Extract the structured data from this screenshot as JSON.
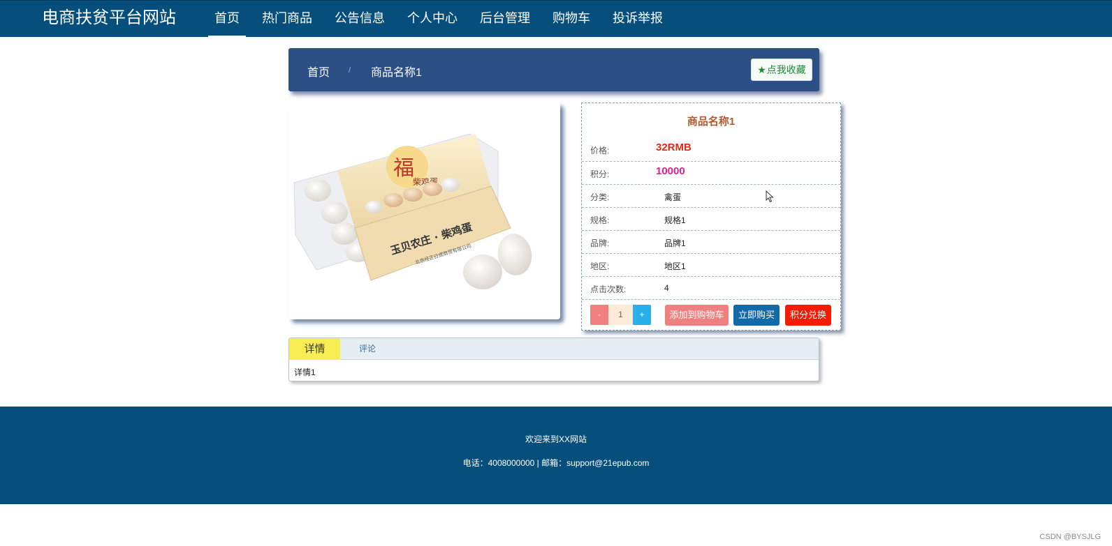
{
  "header": {
    "site_title": "电商扶贫平台网站",
    "nav": [
      {
        "label": "首页",
        "active": true
      },
      {
        "label": "热门商品"
      },
      {
        "label": "公告信息"
      },
      {
        "label": "个人中心"
      },
      {
        "label": "后台管理"
      },
      {
        "label": "购物车"
      },
      {
        "label": "投诉举报"
      }
    ]
  },
  "breadcrumb": {
    "home": "首页",
    "separator": "/",
    "current": "商品名称1",
    "favorite_label": "点我收藏",
    "favorite_icon": "star-icon"
  },
  "product": {
    "image_alt": "柴鸡蛋",
    "name": "商品名称1",
    "rows": [
      {
        "label": "价格:",
        "value": "32RMB"
      },
      {
        "label": "积分:",
        "value": "10000"
      },
      {
        "label": "分类:",
        "value": "禽蛋"
      },
      {
        "label": "规格:",
        "value": "规格1"
      },
      {
        "label": "品牌:",
        "value": "品牌1"
      },
      {
        "label": "地区:",
        "value": "地区1"
      },
      {
        "label": "点击次数:",
        "value": "4"
      }
    ],
    "quantity": {
      "minus": "-",
      "value": "1",
      "plus": "+"
    },
    "buttons": {
      "add_to_cart": "添加到购物车",
      "buy_now": "立即购买",
      "redeem": "积分兑换"
    }
  },
  "tabs": {
    "items": [
      "详情",
      "评论"
    ],
    "active": "详情",
    "content": "详情1"
  },
  "footer": {
    "welcome": "欢迎来到XX网站",
    "contact": "电话：4008000000 | 邮箱：support@21epub.com"
  },
  "watermark": "CSDN @BYSJLG",
  "colors": {
    "nav_bg": "#064f7c",
    "crumb_bg": "#2c4f86",
    "price": "#e02a12",
    "points": "#e0218a",
    "product_name": "#b35a30",
    "tab_active": "#f8ee54"
  }
}
